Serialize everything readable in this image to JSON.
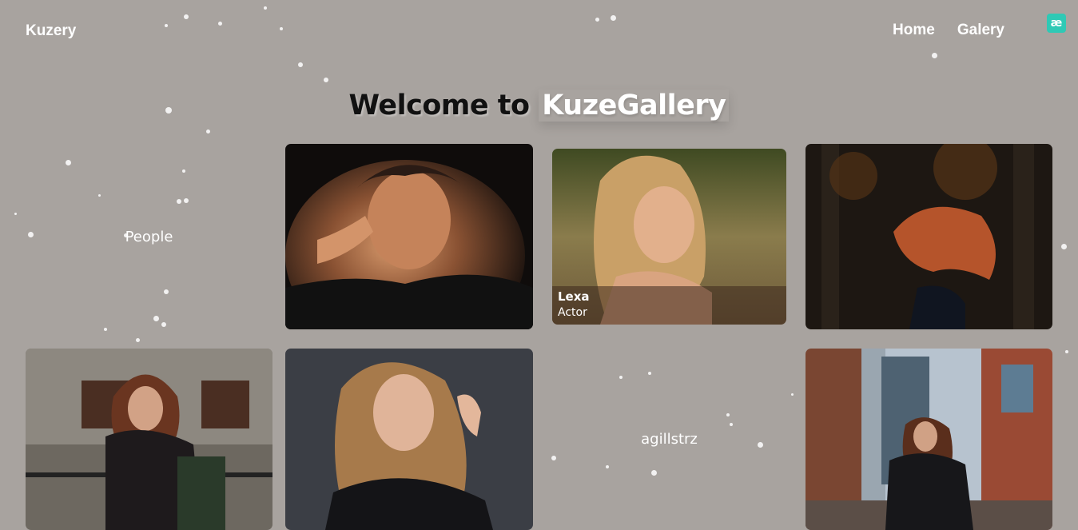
{
  "nav": {
    "logo": "Kuzery",
    "links": [
      "Home",
      "Galery"
    ],
    "badge": "æ"
  },
  "hero": {
    "lead": "Welcome to",
    "brand": "KuzeGallery"
  },
  "gallery": {
    "people_label": "People",
    "author_label": "agillstrz",
    "featured_caption": {
      "name": "Lexa",
      "role": "Actor"
    }
  },
  "photos": [
    {
      "id": "photo-1",
      "subject": "woman with hands on head, dark background"
    },
    {
      "id": "photo-2",
      "subject": "blonde woman in field"
    },
    {
      "id": "photo-3",
      "subject": "woman tossing red hair in autumn forest"
    },
    {
      "id": "photo-4",
      "subject": "woman by railing in street"
    },
    {
      "id": "photo-5",
      "subject": "blonde woman grey studio"
    },
    {
      "id": "photo-6",
      "subject": "woman in leather jacket city street"
    }
  ],
  "colors": {
    "background": "#a8a39f",
    "badge": "#2fc9b5"
  }
}
